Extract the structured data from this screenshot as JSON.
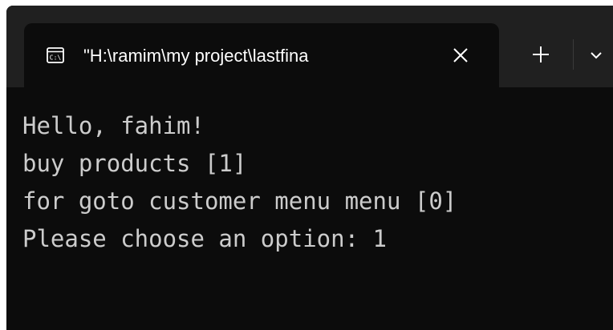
{
  "window": {
    "tab": {
      "icon": "console-icon",
      "title": "\"H:\\ramim\\my project\\lastfina"
    },
    "controls": {
      "close_icon": "close-icon",
      "new_tab_icon": "plus-icon",
      "dropdown_icon": "chevron-down-icon"
    }
  },
  "terminal": {
    "lines": [
      "Hello, fahim!",
      "buy products [1]",
      "for goto customer menu menu [0]",
      "Please choose an option: 1"
    ]
  },
  "colors": {
    "terminal_background": "#0c0c0c",
    "titlebar_background": "#202020",
    "terminal_text": "#cccccc",
    "tab_text": "#ffffff"
  }
}
